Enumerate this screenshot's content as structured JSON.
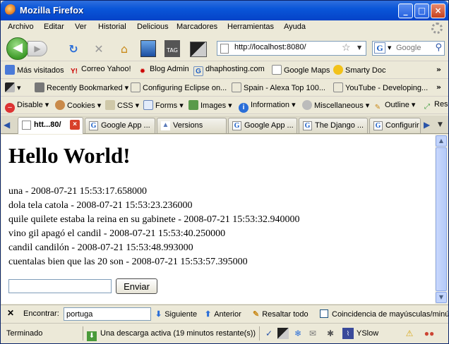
{
  "window": {
    "title": "Mozilla Firefox",
    "minimize": "_",
    "maximize": "□",
    "close": "×"
  },
  "menu": [
    "Archivo",
    "Editar",
    "Ver",
    "Historial",
    "Delicious",
    "Marcadores",
    "Herramientas",
    "Ayuda"
  ],
  "nav": {
    "url": "http://localhost:8080/",
    "search_placeholder": "Google",
    "back_icon": "◀",
    "forward_icon": "▶",
    "reload_icon": "↻",
    "stop_icon": "✕",
    "home_icon": "⌂",
    "tag_label": "TAG"
  },
  "bookmarks": [
    "Más visitados",
    "Correo Yahoo!",
    "Blog Admin",
    "dhaphosting.com",
    "Google Maps",
    "Smarty Doc"
  ],
  "delicious": [
    "Recently Bookmarked",
    "Configuring Eclipse on...",
    "Spain - Alexa Top 100...",
    "YouTube - Developing..."
  ],
  "webdev": [
    "Disable",
    "Cookies",
    "CSS",
    "Forms",
    "Images",
    "Information",
    "Miscellaneous",
    "Outline",
    "Res"
  ],
  "tabs": [
    {
      "label": "htt...80/",
      "active": true
    },
    {
      "label": "Google App ...",
      "active": false
    },
    {
      "label": "Versions",
      "active": false
    },
    {
      "label": "Google App ...",
      "active": false
    },
    {
      "label": "The Django ...",
      "active": false
    },
    {
      "label": "Configurir",
      "active": false
    }
  ],
  "page": {
    "heading": "Hello World!",
    "lines": [
      "una - 2008-07-21 15:53:17.658000",
      "dola tela catola - 2008-07-21 15:53:23.236000",
      "quile quilete estaba la reina en su gabinete - 2008-07-21 15:53:32.940000",
      "vino gil apagó el candil - 2008-07-21 15:53:40.250000",
      "candil candilón - 2008-07-21 15:53:48.993000",
      "cuentalas bien que las 20 son - 2008-07-21 15:53:57.395000"
    ],
    "input_value": "",
    "submit_label": "Enviar"
  },
  "find": {
    "label": "Encontrar:",
    "value": "portuga",
    "next": "Siguiente",
    "prev": "Anterior",
    "highlight": "Resaltar todo",
    "match_case": "Coincidencia de mayúsculas/minús"
  },
  "status": {
    "text": "Terminado",
    "download": "Una descarga activa (19 minutos restante(s))",
    "yslow": "YSlow"
  }
}
